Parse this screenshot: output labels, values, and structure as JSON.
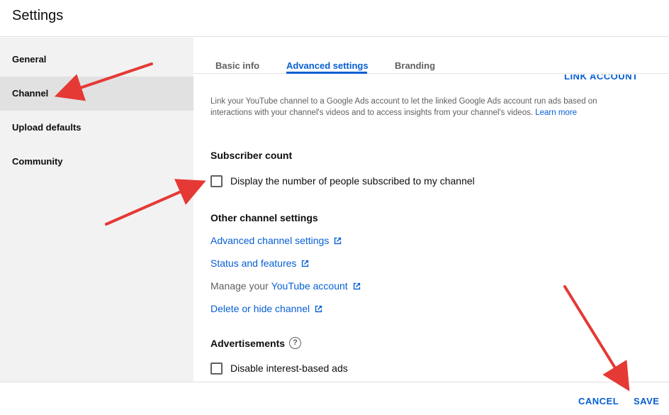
{
  "header": {
    "title": "Settings"
  },
  "sidebar": {
    "items": [
      {
        "label": "General"
      },
      {
        "label": "Channel"
      },
      {
        "label": "Upload defaults"
      },
      {
        "label": "Community"
      }
    ]
  },
  "tabs": [
    {
      "label": "Basic info"
    },
    {
      "label": "Advanced settings"
    },
    {
      "label": "Branding"
    }
  ],
  "ads_link": {
    "cut_button": "LINK ACCOUNT",
    "description": "Link your YouTube channel to a Google Ads account to let the linked Google Ads account run ads based on interactions with your channel's videos and to access insights from your channel's videos.",
    "learn_more": "Learn more"
  },
  "subscriber": {
    "title": "Subscriber count",
    "checkbox_label": "Display the number of people subscribed to my channel"
  },
  "other": {
    "title": "Other channel settings",
    "advanced": "Advanced channel settings",
    "status": "Status and features",
    "manage_prefix": "Manage your",
    "manage_link": "YouTube account",
    "delete": "Delete or hide channel"
  },
  "ads": {
    "title": "Advertisements",
    "help_glyph": "?",
    "checkbox_label": "Disable interest-based ads"
  },
  "footer": {
    "cancel": "CANCEL",
    "save": "SAVE"
  },
  "colors": {
    "accent": "#065fd4",
    "annotation_arrow": "#e53935",
    "sidebar_bg": "#f2f2f2",
    "sidebar_active": "#e1e1e1"
  },
  "icons": {
    "external_link": "open-in-new-icon",
    "help": "help-circle-icon"
  }
}
